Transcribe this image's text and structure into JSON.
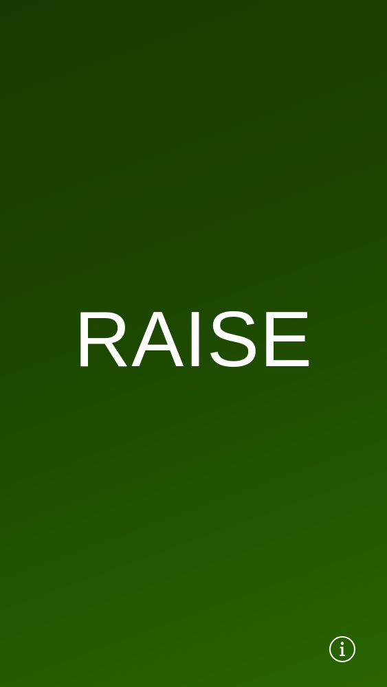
{
  "screen": {
    "title": "RAISE"
  },
  "controls": {
    "info_icon": "info-circle-icon"
  },
  "colors": {
    "background_top": "#173a00",
    "background_bottom": "#2a6400",
    "text": "#ffffff"
  }
}
